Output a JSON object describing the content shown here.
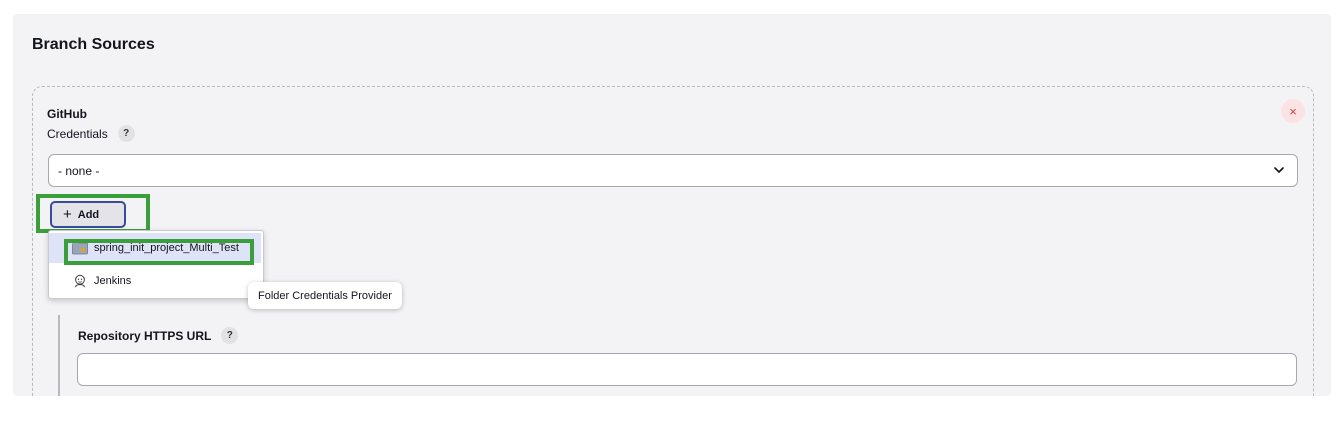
{
  "section": {
    "title": "Branch Sources"
  },
  "github": {
    "title": "GitHub",
    "credentials_label": "Credentials",
    "help_glyph": "?",
    "remove_glyph": "×",
    "credentials_value": "- none -",
    "add_label": "Add",
    "add_glyph": "+",
    "menu": [
      {
        "label": "spring_init_project_Multi_Test",
        "icon": "folder-icon"
      },
      {
        "label": "Jenkins",
        "icon": "jenkins-icon"
      }
    ],
    "tooltip": "Folder Credentials Provider",
    "repo_url_label": "Repository HTTPS URL",
    "repo_url_value": ""
  },
  "colors": {
    "highlight": "#3a9e3a",
    "add_border": "#3b4a9a",
    "menu_active": "#dfe3f7",
    "remove": "#d24242"
  }
}
